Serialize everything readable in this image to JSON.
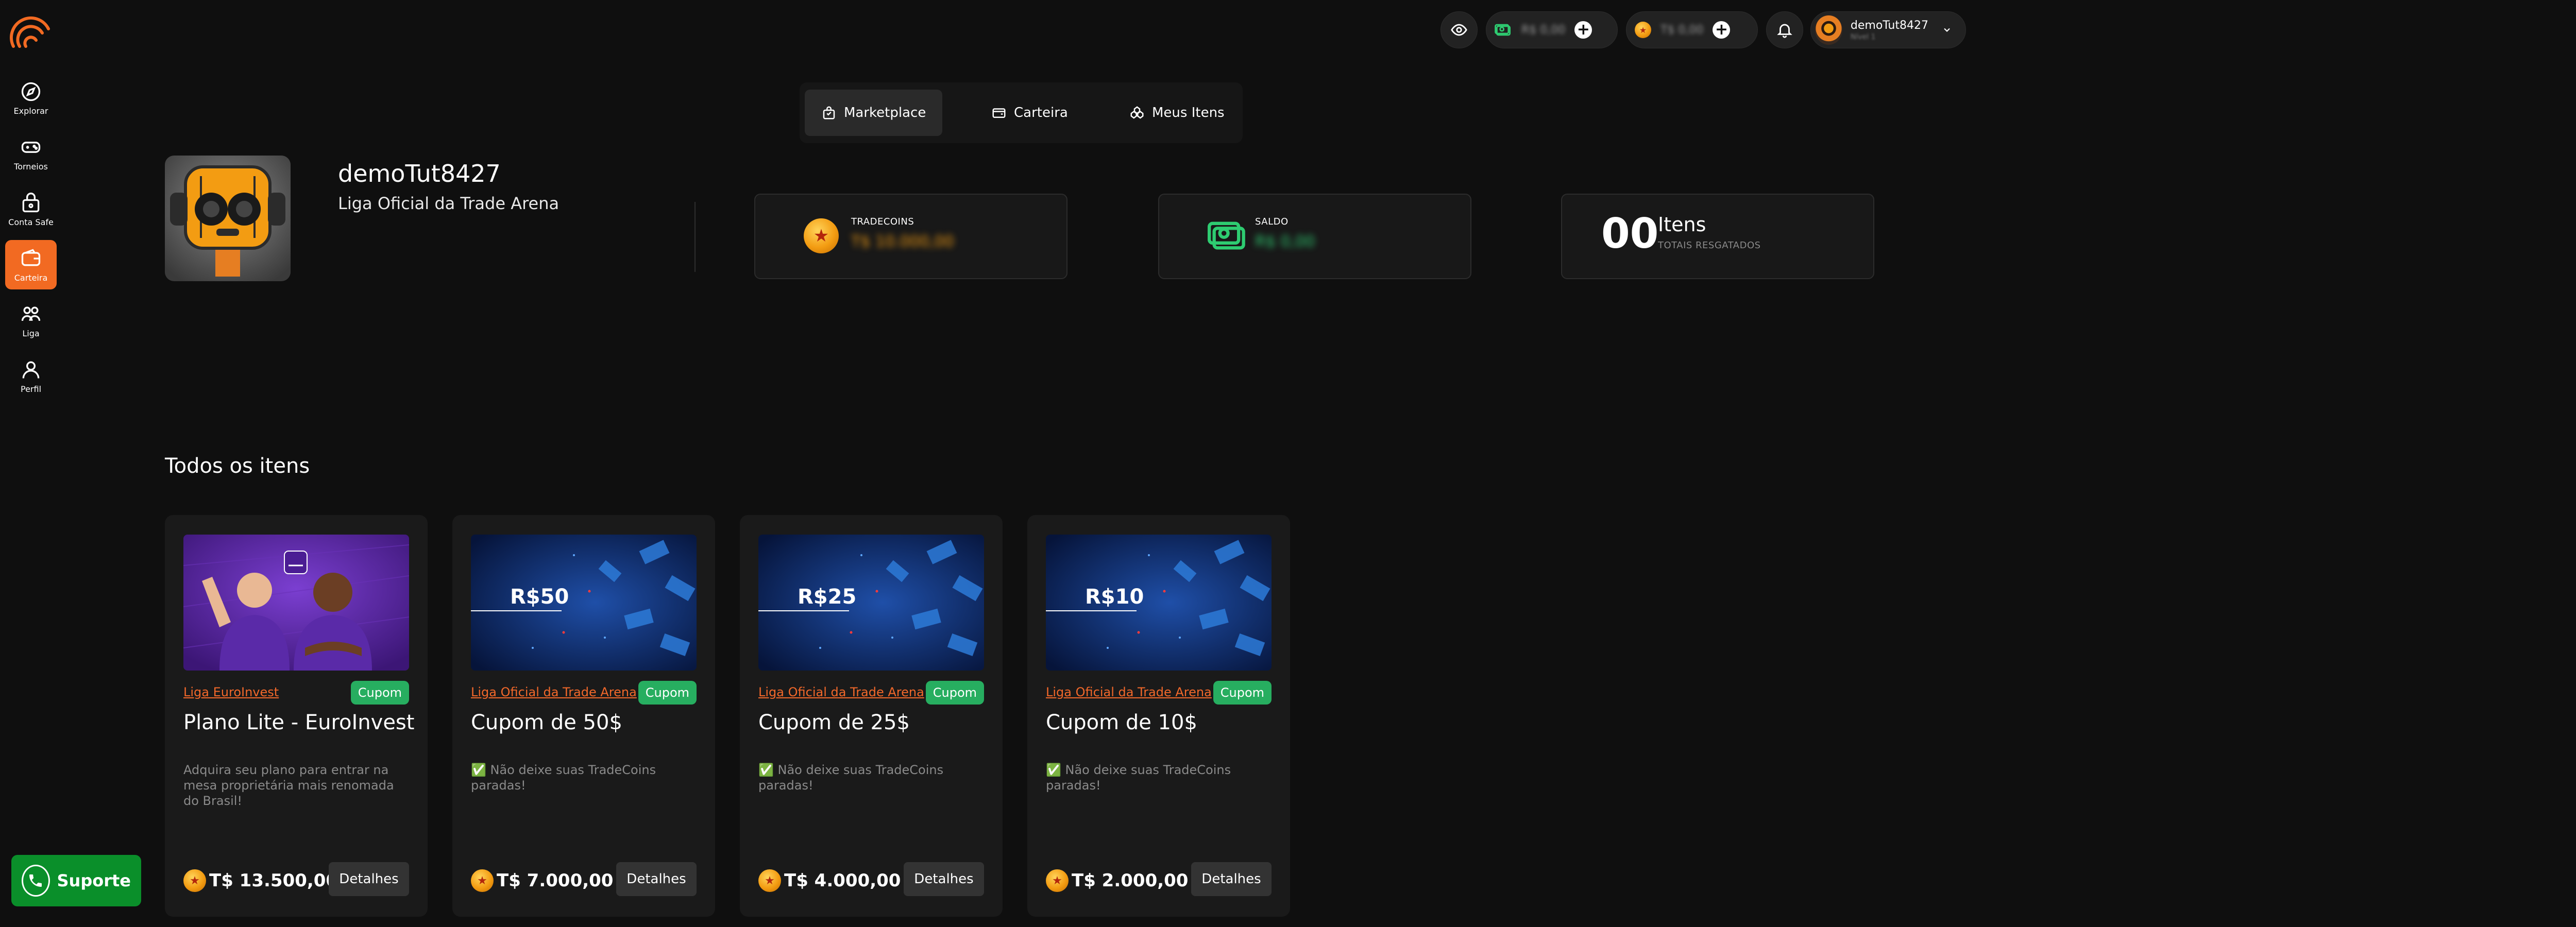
{
  "colors": {
    "accent": "#f26a22",
    "success": "#27ae60",
    "support": "#0a8f2a"
  },
  "sidebar": {
    "items": [
      {
        "label": "Explorar",
        "icon": "compass-icon"
      },
      {
        "label": "Torneios",
        "icon": "controller-icon"
      },
      {
        "label": "Conta Safe",
        "icon": "safe-icon"
      },
      {
        "label": "Carteira",
        "icon": "wallet-icon",
        "active": true
      },
      {
        "label": "Liga",
        "icon": "league-icon"
      },
      {
        "label": "Perfil",
        "icon": "user-icon"
      }
    ],
    "support_label": "Suporte"
  },
  "topbar": {
    "cash_balance": "R$ 0,00",
    "coin_balance": "T$ 0,00",
    "username": "demoTut8427",
    "level": "Nível 1"
  },
  "tabs": [
    {
      "label": "Marketplace",
      "icon": "bag-icon",
      "active": true
    },
    {
      "label": "Carteira",
      "icon": "wallet-icon"
    },
    {
      "label": "Meus Itens",
      "icon": "items-icon"
    }
  ],
  "profile": {
    "name": "demoTut8427",
    "league": "Liga Oficial da Trade Arena"
  },
  "stats": {
    "tradecoins_label": "TRADECOINS",
    "tradecoins_value": "T$ 10.000,00",
    "saldo_label": "SALDO",
    "saldo_value": "R$ 0,00",
    "items_count": "00",
    "items_title": "Itens",
    "items_sub": "TOTAIS RESGATADOS"
  },
  "section_title": "Todos os itens",
  "details_label": "Detalhes",
  "items": [
    {
      "league": "Liga EuroInvest",
      "badge": "Cupom",
      "title": "Plano Lite - EuroInvest",
      "description": "Adquira seu plano para entrar na mesa proprietária mais renomada do Brasil!",
      "price": "T$ 13.500,00",
      "image_text": ""
    },
    {
      "league": "Liga Oficial da Trade Arena",
      "badge": "Cupom",
      "title": "Cupom de 50$",
      "description": "✅ Não deixe suas TradeCoins paradas!",
      "price": "T$ 7.000,00",
      "image_text": "R$50"
    },
    {
      "league": "Liga Oficial da Trade Arena",
      "badge": "Cupom",
      "title": "Cupom de 25$",
      "description": "✅ Não deixe suas TradeCoins paradas!",
      "price": "T$ 4.000,00",
      "image_text": "R$25"
    },
    {
      "league": "Liga Oficial da Trade Arena",
      "badge": "Cupom",
      "title": "Cupom de 10$",
      "description": "✅ Não deixe suas TradeCoins paradas!",
      "price": "T$ 2.000,00",
      "image_text": "R$10"
    }
  ]
}
